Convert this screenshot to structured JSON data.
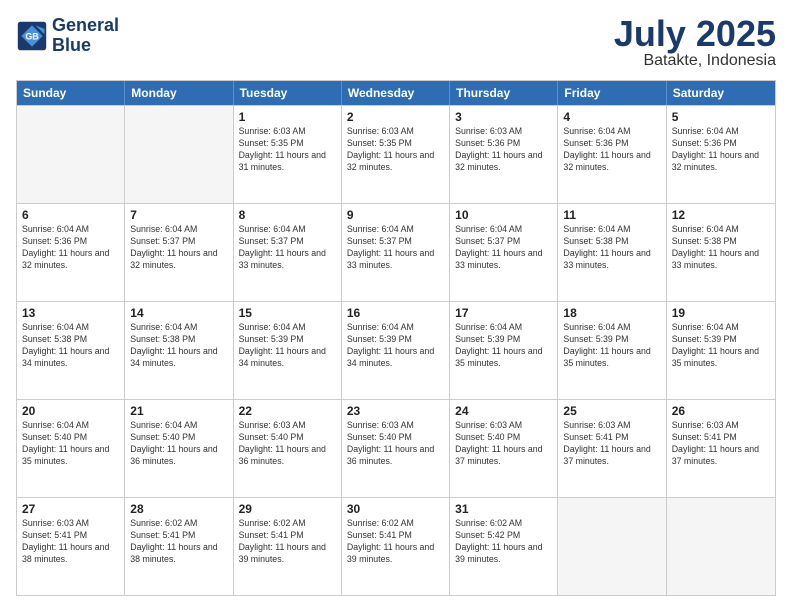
{
  "logo": {
    "line1": "General",
    "line2": "Blue"
  },
  "header": {
    "month": "July 2025",
    "location": "Batakte, Indonesia"
  },
  "weekdays": [
    "Sunday",
    "Monday",
    "Tuesday",
    "Wednesday",
    "Thursday",
    "Friday",
    "Saturday"
  ],
  "weeks": [
    [
      {
        "day": "",
        "info": ""
      },
      {
        "day": "",
        "info": ""
      },
      {
        "day": "1",
        "info": "Sunrise: 6:03 AM\nSunset: 5:35 PM\nDaylight: 11 hours and 31 minutes."
      },
      {
        "day": "2",
        "info": "Sunrise: 6:03 AM\nSunset: 5:35 PM\nDaylight: 11 hours and 32 minutes."
      },
      {
        "day": "3",
        "info": "Sunrise: 6:03 AM\nSunset: 5:36 PM\nDaylight: 11 hours and 32 minutes."
      },
      {
        "day": "4",
        "info": "Sunrise: 6:04 AM\nSunset: 5:36 PM\nDaylight: 11 hours and 32 minutes."
      },
      {
        "day": "5",
        "info": "Sunrise: 6:04 AM\nSunset: 5:36 PM\nDaylight: 11 hours and 32 minutes."
      }
    ],
    [
      {
        "day": "6",
        "info": "Sunrise: 6:04 AM\nSunset: 5:36 PM\nDaylight: 11 hours and 32 minutes."
      },
      {
        "day": "7",
        "info": "Sunrise: 6:04 AM\nSunset: 5:37 PM\nDaylight: 11 hours and 32 minutes."
      },
      {
        "day": "8",
        "info": "Sunrise: 6:04 AM\nSunset: 5:37 PM\nDaylight: 11 hours and 33 minutes."
      },
      {
        "day": "9",
        "info": "Sunrise: 6:04 AM\nSunset: 5:37 PM\nDaylight: 11 hours and 33 minutes."
      },
      {
        "day": "10",
        "info": "Sunrise: 6:04 AM\nSunset: 5:37 PM\nDaylight: 11 hours and 33 minutes."
      },
      {
        "day": "11",
        "info": "Sunrise: 6:04 AM\nSunset: 5:38 PM\nDaylight: 11 hours and 33 minutes."
      },
      {
        "day": "12",
        "info": "Sunrise: 6:04 AM\nSunset: 5:38 PM\nDaylight: 11 hours and 33 minutes."
      }
    ],
    [
      {
        "day": "13",
        "info": "Sunrise: 6:04 AM\nSunset: 5:38 PM\nDaylight: 11 hours and 34 minutes."
      },
      {
        "day": "14",
        "info": "Sunrise: 6:04 AM\nSunset: 5:38 PM\nDaylight: 11 hours and 34 minutes."
      },
      {
        "day": "15",
        "info": "Sunrise: 6:04 AM\nSunset: 5:39 PM\nDaylight: 11 hours and 34 minutes."
      },
      {
        "day": "16",
        "info": "Sunrise: 6:04 AM\nSunset: 5:39 PM\nDaylight: 11 hours and 34 minutes."
      },
      {
        "day": "17",
        "info": "Sunrise: 6:04 AM\nSunset: 5:39 PM\nDaylight: 11 hours and 35 minutes."
      },
      {
        "day": "18",
        "info": "Sunrise: 6:04 AM\nSunset: 5:39 PM\nDaylight: 11 hours and 35 minutes."
      },
      {
        "day": "19",
        "info": "Sunrise: 6:04 AM\nSunset: 5:39 PM\nDaylight: 11 hours and 35 minutes."
      }
    ],
    [
      {
        "day": "20",
        "info": "Sunrise: 6:04 AM\nSunset: 5:40 PM\nDaylight: 11 hours and 35 minutes."
      },
      {
        "day": "21",
        "info": "Sunrise: 6:04 AM\nSunset: 5:40 PM\nDaylight: 11 hours and 36 minutes."
      },
      {
        "day": "22",
        "info": "Sunrise: 6:03 AM\nSunset: 5:40 PM\nDaylight: 11 hours and 36 minutes."
      },
      {
        "day": "23",
        "info": "Sunrise: 6:03 AM\nSunset: 5:40 PM\nDaylight: 11 hours and 36 minutes."
      },
      {
        "day": "24",
        "info": "Sunrise: 6:03 AM\nSunset: 5:40 PM\nDaylight: 11 hours and 37 minutes."
      },
      {
        "day": "25",
        "info": "Sunrise: 6:03 AM\nSunset: 5:41 PM\nDaylight: 11 hours and 37 minutes."
      },
      {
        "day": "26",
        "info": "Sunrise: 6:03 AM\nSunset: 5:41 PM\nDaylight: 11 hours and 37 minutes."
      }
    ],
    [
      {
        "day": "27",
        "info": "Sunrise: 6:03 AM\nSunset: 5:41 PM\nDaylight: 11 hours and 38 minutes."
      },
      {
        "day": "28",
        "info": "Sunrise: 6:02 AM\nSunset: 5:41 PM\nDaylight: 11 hours and 38 minutes."
      },
      {
        "day": "29",
        "info": "Sunrise: 6:02 AM\nSunset: 5:41 PM\nDaylight: 11 hours and 39 minutes."
      },
      {
        "day": "30",
        "info": "Sunrise: 6:02 AM\nSunset: 5:41 PM\nDaylight: 11 hours and 39 minutes."
      },
      {
        "day": "31",
        "info": "Sunrise: 6:02 AM\nSunset: 5:42 PM\nDaylight: 11 hours and 39 minutes."
      },
      {
        "day": "",
        "info": ""
      },
      {
        "day": "",
        "info": ""
      }
    ]
  ]
}
